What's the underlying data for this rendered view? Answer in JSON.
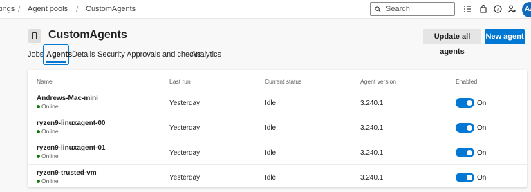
{
  "breadcrumb": {
    "project_settings": "tings",
    "agent_pools": "Agent pools",
    "current_pool": "CustomAgents",
    "separator": "/"
  },
  "topbar": {
    "search_placeholder": "Search",
    "avatar_initials": "AA",
    "icons": [
      "search-icon",
      "checklist-icon",
      "shopping-bag-icon",
      "help-icon",
      "user-settings-icon"
    ]
  },
  "pool": {
    "title": "CustomAgents",
    "update_all_label": "Update all agents",
    "new_agent_label": "New agent"
  },
  "tabs": [
    {
      "label": "Jobs",
      "active": false
    },
    {
      "label": "Agents",
      "active": true
    },
    {
      "label": "Details",
      "active": false
    },
    {
      "label": "Security",
      "active": false
    },
    {
      "label": "Approvals and checks",
      "active": false
    },
    {
      "label": "Analytics",
      "active": false
    }
  ],
  "table": {
    "columns": [
      "Name",
      "Last run",
      "Current status",
      "Agent version",
      "Enabled"
    ],
    "rows": [
      {
        "name": "Andrews-Mac-mini",
        "status": "Online",
        "last_run": "Yesterday",
        "current_status": "Idle",
        "version": "3.240.1",
        "enabled": "On"
      },
      {
        "name": "ryzen9-linuxagent-00",
        "status": "Online",
        "last_run": "Yesterday",
        "current_status": "Idle",
        "version": "3.240.1",
        "enabled": "On"
      },
      {
        "name": "ryzen9-linuxagent-01",
        "status": "Online",
        "last_run": "Yesterday",
        "current_status": "Idle",
        "version": "3.240.1",
        "enabled": "On"
      },
      {
        "name": "ryzen9-trusted-vm",
        "status": "Online",
        "last_run": "Yesterday",
        "current_status": "Idle",
        "version": "3.240.1",
        "enabled": "On"
      }
    ]
  },
  "colors": {
    "accent": "#0078d4",
    "online": "#107c10"
  }
}
